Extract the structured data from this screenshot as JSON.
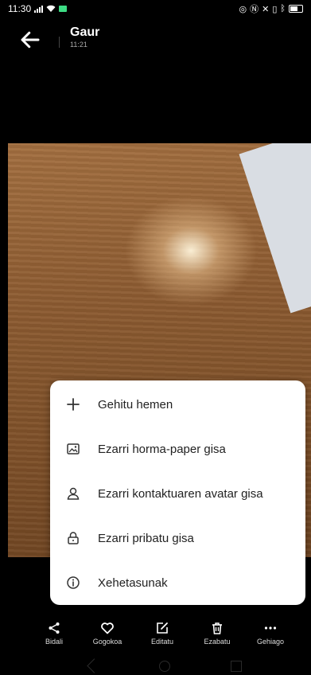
{
  "status_bar": {
    "time": "11:30",
    "icons_left": [
      "signal-icon",
      "wifi-icon",
      "battery-saver-icon"
    ],
    "icons_right": [
      "nfc-icon",
      "n-icon",
      "mute-icon",
      "vibrate-icon",
      "bluetooth-icon",
      "battery-icon"
    ]
  },
  "header": {
    "title": "Gaur",
    "subtitle": "11:21"
  },
  "menu": {
    "items": [
      {
        "label": "Gehitu hemen",
        "icon": "plus-icon"
      },
      {
        "label": "Ezarri horma-paper gisa",
        "icon": "wallpaper-icon"
      },
      {
        "label": "Ezarri kontaktuaren avatar gisa",
        "icon": "contact-icon"
      },
      {
        "label": "Ezarri pribatu gisa",
        "icon": "lock-icon"
      },
      {
        "label": "Xehetasunak",
        "icon": "info-icon"
      }
    ]
  },
  "bottom_bar": {
    "items": [
      {
        "label": "Bidali",
        "icon": "share-icon"
      },
      {
        "label": "Gogokoa",
        "icon": "heart-icon"
      },
      {
        "label": "Editatu",
        "icon": "edit-icon"
      },
      {
        "label": "Ezabatu",
        "icon": "trash-icon"
      },
      {
        "label": "Gehiago",
        "icon": "more-icon"
      }
    ]
  },
  "colors": {
    "background": "#000000",
    "menu_background": "#ffffff",
    "battery_saver": "#3ddc84"
  }
}
